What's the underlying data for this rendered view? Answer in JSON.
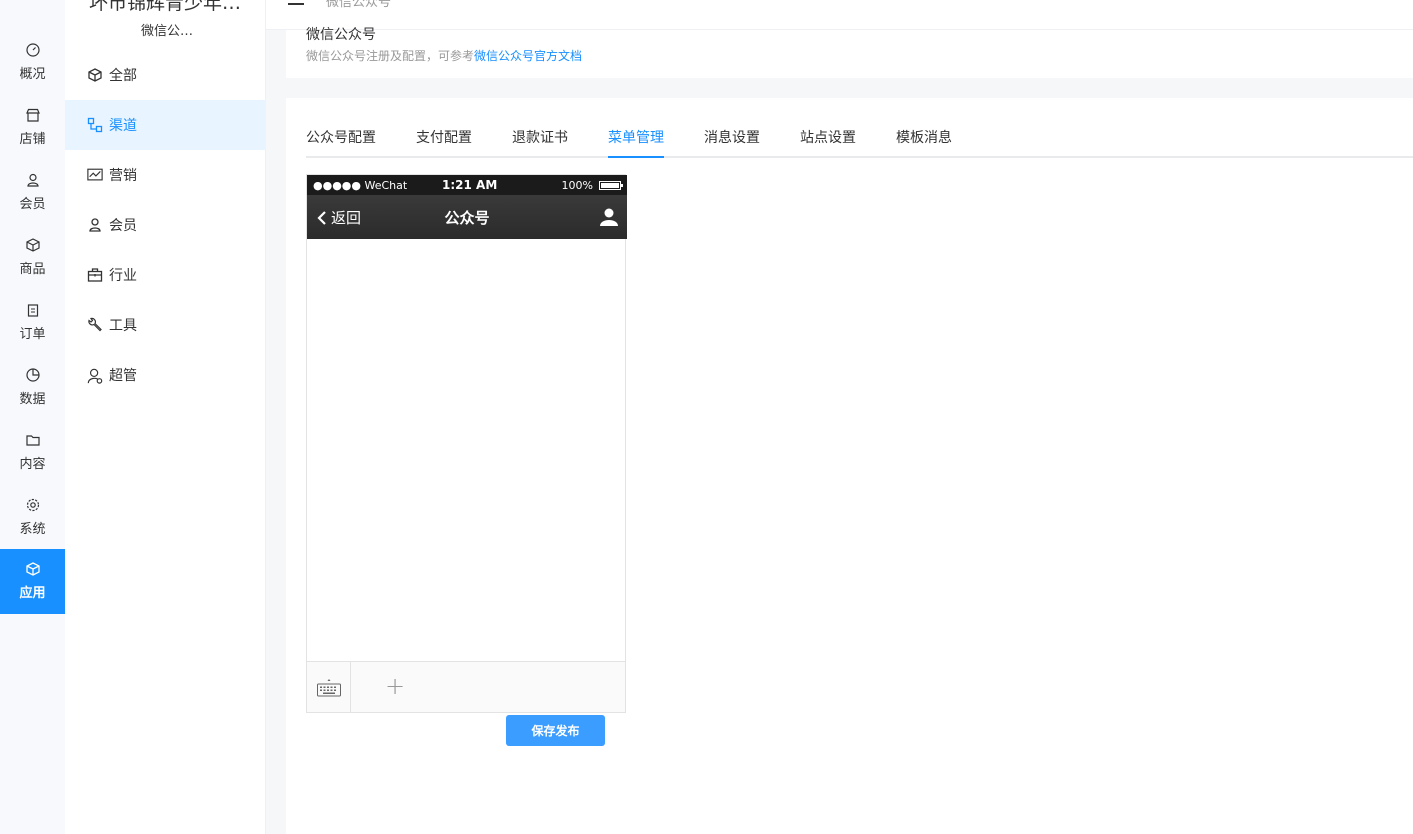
{
  "rail": {
    "items": [
      {
        "label": "概况",
        "icon": "dashboard-icon"
      },
      {
        "label": "店铺",
        "icon": "store-icon"
      },
      {
        "label": "会员",
        "icon": "user-icon"
      },
      {
        "label": "商品",
        "icon": "box-icon"
      },
      {
        "label": "订单",
        "icon": "clipboard-icon"
      },
      {
        "label": "数据",
        "icon": "pie-chart-icon"
      },
      {
        "label": "内容",
        "icon": "folder-icon"
      },
      {
        "label": "系统",
        "icon": "gear-icon"
      },
      {
        "label": "应用",
        "icon": "cube-icon",
        "active": true
      }
    ]
  },
  "subnav": {
    "shop_title": "坏市锦辉青少年…",
    "shop_sub": "微信公…",
    "items": [
      {
        "label": "全部",
        "icon": "cube-icon"
      },
      {
        "label": "渠道",
        "icon": "channel-icon",
        "active": true
      },
      {
        "label": "营销",
        "icon": "chart-line-icon"
      },
      {
        "label": "会员",
        "icon": "user-icon"
      },
      {
        "label": "行业",
        "icon": "briefcase-icon"
      },
      {
        "label": "工具",
        "icon": "wrench-icon"
      },
      {
        "label": "超管",
        "icon": "admin-icon"
      }
    ]
  },
  "topbar": {
    "breadcrumb": "微信公众号"
  },
  "page_head": {
    "title": "微信公众号",
    "desc": "微信公众号注册及配置，可参考",
    "link": "微信公众号官方文档"
  },
  "tabs": [
    {
      "label": "公众号配置"
    },
    {
      "label": "支付配置"
    },
    {
      "label": "退款证书"
    },
    {
      "label": "菜单管理",
      "active": true
    },
    {
      "label": "消息设置"
    },
    {
      "label": "站点设置"
    },
    {
      "label": "模板消息"
    }
  ],
  "phone": {
    "carrier": "●●●●● WeChat",
    "time": "1:21 AM",
    "battery": "100%",
    "back": "返回",
    "title": "公众号",
    "plus": "+"
  },
  "save_button": "保存发布",
  "colors": {
    "accent": "#1890ff",
    "button": "#3b9dff"
  }
}
